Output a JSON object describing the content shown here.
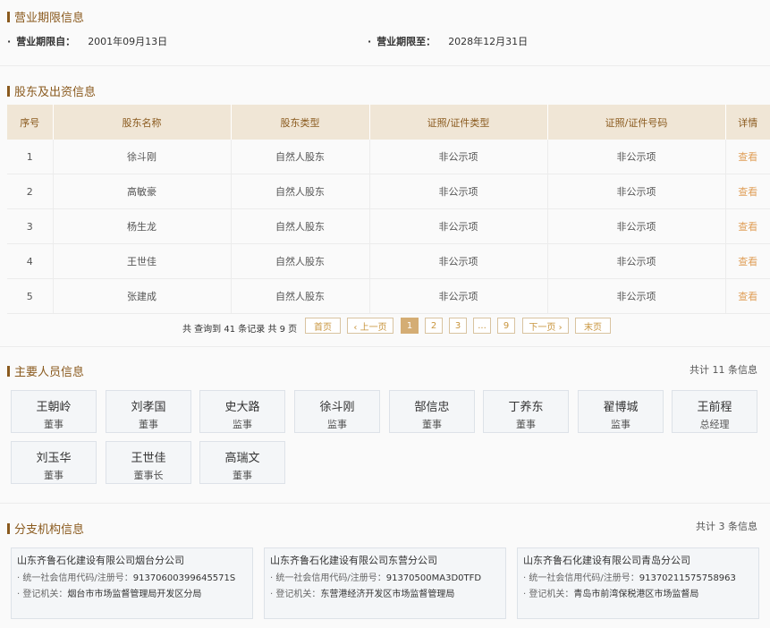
{
  "period": {
    "title": "营业期限信息",
    "from_label": "营业期限自：",
    "from_value": "2001年09月13日",
    "to_label": "营业期限至：",
    "to_value": "2028年12月31日"
  },
  "shareholders": {
    "title": "股东及出资信息",
    "columns": [
      "序号",
      "股东名称",
      "股东类型",
      "证照/证件类型",
      "证照/证件号码",
      "详情"
    ],
    "rows": [
      {
        "no": "1",
        "name": "徐斗刚",
        "type": "自然人股东",
        "cert_type": "非公示项",
        "cert_no": "非公示项",
        "detail": "查看"
      },
      {
        "no": "2",
        "name": "高敏豪",
        "type": "自然人股东",
        "cert_type": "非公示项",
        "cert_no": "非公示项",
        "detail": "查看"
      },
      {
        "no": "3",
        "name": "杨生龙",
        "type": "自然人股东",
        "cert_type": "非公示项",
        "cert_no": "非公示项",
        "detail": "查看"
      },
      {
        "no": "4",
        "name": "王世佳",
        "type": "自然人股东",
        "cert_type": "非公示项",
        "cert_no": "非公示项",
        "detail": "查看"
      },
      {
        "no": "5",
        "name": "张建成",
        "type": "自然人股东",
        "cert_type": "非公示项",
        "cert_no": "非公示项",
        "detail": "查看"
      }
    ],
    "pagination": {
      "info": "共 查询到 41 条记录 共 9 页",
      "first": "首页",
      "prev": "‹ 上一页",
      "pages": [
        "1",
        "2",
        "3",
        "...",
        "9"
      ],
      "active": "1",
      "next": "下一页 ›",
      "last": "末页"
    }
  },
  "personnel": {
    "title": "主要人员信息",
    "count": "共计 11 条信息",
    "people": [
      {
        "name": "王朝岭",
        "role": "董事"
      },
      {
        "name": "刘孝国",
        "role": "董事"
      },
      {
        "name": "史大路",
        "role": "监事"
      },
      {
        "name": "徐斗刚",
        "role": "监事"
      },
      {
        "name": "郜信忠",
        "role": "董事"
      },
      {
        "name": "丁养东",
        "role": "董事"
      },
      {
        "name": "翟博城",
        "role": "监事"
      },
      {
        "name": "王前程",
        "role": "总经理"
      },
      {
        "name": "刘玉华",
        "role": "董事"
      },
      {
        "name": "王世佳",
        "role": "董事长"
      },
      {
        "name": "高瑞文",
        "role": "董事"
      }
    ]
  },
  "branches": {
    "title": "分支机构信息",
    "count": "共计 3 条信息",
    "items": [
      {
        "name": "山东齐鲁石化建设有限公司烟台分公司",
        "code_label": "· 统一社会信用代码/注册号：",
        "code": "91370600399645571S",
        "reg_label": "· 登记机关：",
        "reg": "烟台市市场监督管理局开发区分局"
      },
      {
        "name": "山东齐鲁石化建设有限公司东营分公司",
        "code_label": "· 统一社会信用代码/注册号：",
        "code": "91370500MA3D0TFD",
        "reg_label": "· 登记机关：",
        "reg": "东营港经济开发区市场监督管理局"
      },
      {
        "name": "山东齐鲁石化建设有限公司青岛分公司",
        "code_label": "· 统一社会信用代码/注册号：",
        "code": "91370211575758963",
        "reg_label": "· 登记机关：",
        "reg": "青岛市前湾保税港区市场监督局"
      }
    ]
  }
}
